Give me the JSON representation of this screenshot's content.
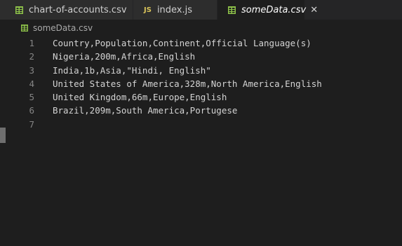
{
  "tabs": [
    {
      "label": "chart-of-accounts.csv",
      "icon": "csv-grid-icon",
      "active": false
    },
    {
      "label": "index.js",
      "icon": "js-icon",
      "icon_text": "JS",
      "active": false
    },
    {
      "label": "someData.csv",
      "icon": "csv-grid-icon",
      "active": true,
      "close": "✕"
    }
  ],
  "breadcrumb": {
    "label": "someData.csv",
    "icon": "csv-grid-icon"
  },
  "lines": [
    {
      "num": "1",
      "text": "Country,Population,Continent,Official Language(s)"
    },
    {
      "num": "2",
      "text": "Nigeria,200m,Africa,English"
    },
    {
      "num": "3",
      "text": "India,1b,Asia,\"Hindi, English\""
    },
    {
      "num": "4",
      "text": "United States of America,328m,North America,English"
    },
    {
      "num": "5",
      "text": "United Kingdom,66m,Europe,English"
    },
    {
      "num": "6",
      "text": "Brazil,209m,South America,Portugese"
    },
    {
      "num": "7",
      "text": ""
    }
  ],
  "colors": {
    "background": "#1e1e1e",
    "tab_inactive": "#2d2d2d",
    "csv_icon": "#8dc149",
    "js_icon": "#d8c35a"
  }
}
